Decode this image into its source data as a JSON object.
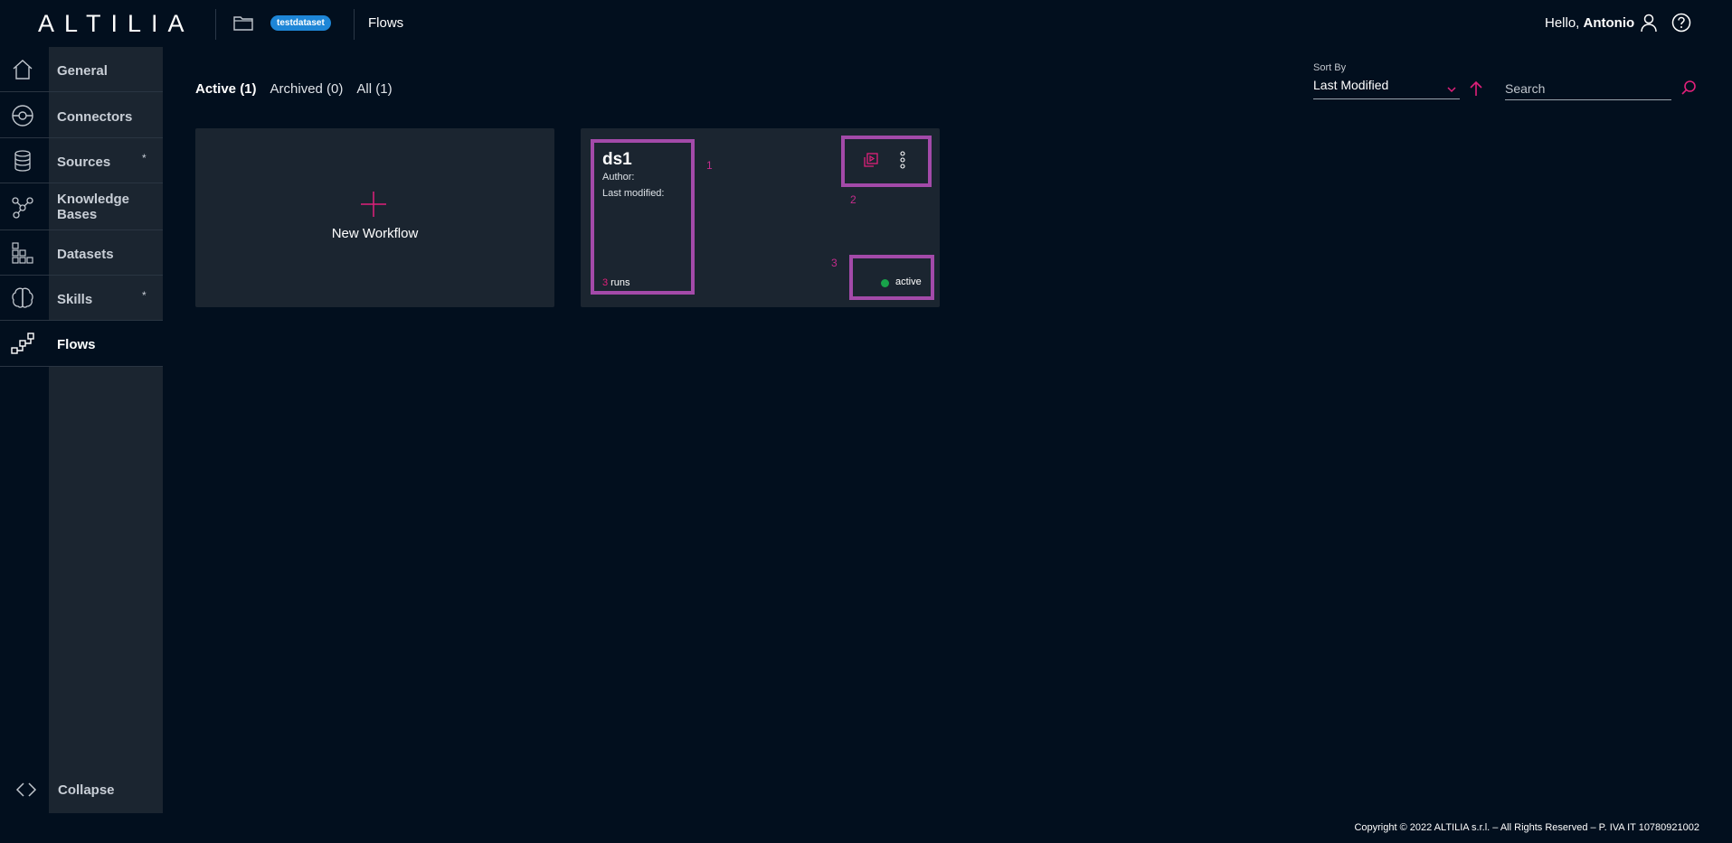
{
  "header": {
    "logo": "ALTILIA",
    "dataset_badge": "testdataset",
    "page": "Flows",
    "greeting": "Hello,",
    "user_name": "Antonio"
  },
  "sidebar": {
    "items": [
      {
        "label": "General",
        "icon": "home-icon",
        "star": ""
      },
      {
        "label": "Connectors",
        "icon": "connector-icon",
        "star": ""
      },
      {
        "label": "Sources",
        "icon": "database-icon",
        "star": "*"
      },
      {
        "label": "Knowledge Bases",
        "icon": "graph-icon",
        "star": ""
      },
      {
        "label": "Datasets",
        "icon": "grid-icon",
        "star": ""
      },
      {
        "label": "Skills",
        "icon": "brain-icon",
        "star": "*"
      },
      {
        "label": "Flows",
        "icon": "flow-icon",
        "star": "",
        "active": true
      }
    ],
    "collapse_label": "Collapse"
  },
  "tabs": [
    {
      "label": "Active (1)",
      "active": true
    },
    {
      "label": "Archived (0)",
      "active": false
    },
    {
      "label": "All (1)",
      "active": false
    }
  ],
  "sort": {
    "label": "Sort By",
    "value": "Last Modified"
  },
  "search": {
    "placeholder": "Search",
    "value": ""
  },
  "new_workflow": {
    "label": "New Workflow"
  },
  "flow_card": {
    "title": "ds1",
    "author_label": "Author:",
    "modified_label": "Last modified:",
    "run_count": "3",
    "runs_label": "runs",
    "status": "active",
    "markers": [
      "1",
      "2",
      "3"
    ]
  },
  "footer": {
    "copyright": "Copyright © 2022 ALTILIA s.r.l. – All Rights Reserved – P. IVA IT 10780921002"
  },
  "colors": {
    "background": "#020f1e",
    "panel": "#1b2530",
    "accent": "#e0207a",
    "badge": "#1e86d7",
    "highlight": "#a34aa9",
    "status_active": "#18a34a"
  }
}
